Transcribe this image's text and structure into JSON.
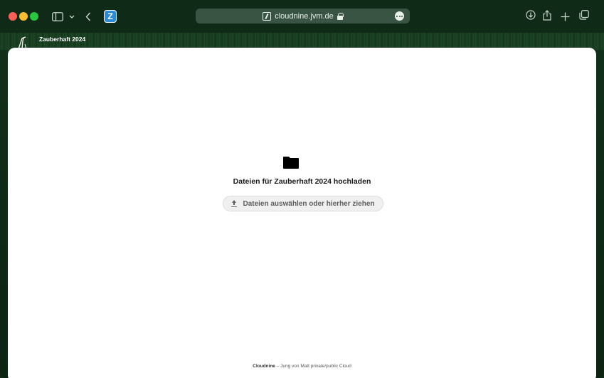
{
  "browser": {
    "url": "cloudnine.jvm.de",
    "tab_title": "Zauberhaft 2024",
    "favicon_letter": "Z"
  },
  "main": {
    "upload_heading": "Dateien für Zauberhaft 2024 hochladen",
    "upload_button_label": "Dateien auswählen oder hierher ziehen"
  },
  "footer": {
    "brand": "Cloudnine",
    "tagline": " – Jung von Matt private/public Cloud"
  },
  "colors": {
    "window_bg": "#102a18",
    "url_bar": "#3a5444",
    "content_bg": "#ffffff"
  },
  "icons": [
    "sidebar-icon",
    "chevron-down-icon",
    "back-icon",
    "lock-icon",
    "more-icon",
    "download-icon",
    "share-icon",
    "plus-icon",
    "tabs-overview-icon",
    "folder-icon",
    "upload-icon"
  ]
}
